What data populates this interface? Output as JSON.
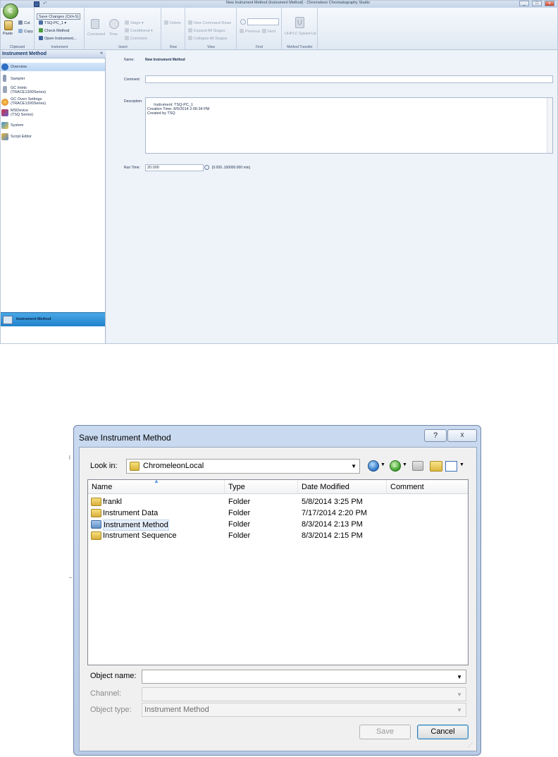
{
  "app": {
    "title": "New Instrument Method (Instrument Method) - Chromeleon Chromatography Studio",
    "orb_label": "C",
    "tooltip": "Save Changes (Ctrl+S)",
    "win_controls": [
      "_",
      "□",
      "x"
    ]
  },
  "ribbon": {
    "clipboard": {
      "paste": "Paste",
      "cut": "Cut",
      "copy": "Copy",
      "label": "Clipboard"
    },
    "instrument": {
      "selector": "TSQ-PC_1",
      "check": "Check Method",
      "open": "Open Instrument...",
      "label": "Instrument"
    },
    "insert": {
      "command": "Command",
      "time": "Time",
      "stage": "Stage",
      "conditional": "Conditional",
      "comment": "Comment",
      "label": "Insert"
    },
    "row": {
      "delete": "Delete",
      "label": "Row"
    },
    "view": {
      "new_rows": "New Command Rows",
      "expand": "Expand All Stages",
      "collapse": "Collapse All Stages",
      "label": "View"
    },
    "find": {
      "previous": "Previous",
      "next": "Next",
      "label": "Find"
    },
    "transfer": {
      "uhplc": "UHPLC Speed-Up",
      "label": "Method Transfer"
    }
  },
  "nav": {
    "title": "Instrument Method",
    "collapse": "«",
    "items": [
      {
        "label": "Overview"
      },
      {
        "label": "Sampler"
      },
      {
        "label": "GC Inlets\n(TRACE1300Series)"
      },
      {
        "label": "GC Oven Settings\n(TRACE1300Series)"
      },
      {
        "label": "MSDevice\n(TSQ Series)"
      },
      {
        "label": "System"
      },
      {
        "label": "Script Editor"
      }
    ],
    "bottom": "Instrument Method"
  },
  "content": {
    "name_label": "Name:",
    "name_value": "New Instrument Method",
    "comment_label": "Comment:",
    "comment_value": "",
    "description_label": "Description:",
    "description_value": "Instrument: TSQ-PC_1\nCreation Time: 8/5/2014 2:06:34 PM\nCreated by TSQ",
    "runtime_label": "Run Time:",
    "runtime_value": "20.000",
    "runtime_range": "[0.000..100000.000 min]"
  },
  "dialog": {
    "title": "Save Instrument Method",
    "help": "?",
    "close": "☓",
    "look_in_label": "Look in:",
    "look_in_value": "ChromeleonLocal",
    "columns": [
      "Name",
      "Type",
      "Date Modified",
      "Comment"
    ],
    "rows": [
      {
        "name": "frankl",
        "type": "Folder",
        "date": "5/8/2014 3:25 PM",
        "comment": ""
      },
      {
        "name": "Instrument Data",
        "type": "Folder",
        "date": "7/17/2014 2:20 PM",
        "comment": ""
      },
      {
        "name": "Instrument Method",
        "type": "Folder",
        "date": "8/3/2014 2:13 PM",
        "comment": ""
      },
      {
        "name": "Instrument Sequence",
        "type": "Folder",
        "date": "8/3/2014 2:15 PM",
        "comment": ""
      }
    ],
    "object_name_label": "Object name:",
    "object_name_value": "",
    "channel_label": "Channel:",
    "channel_value": "",
    "object_type_label": "Object type:",
    "object_type_value": "Instrument Method",
    "save_button": "Save",
    "cancel_button": "Cancel"
  },
  "stray_marks": [
    "l",
    "_"
  ]
}
